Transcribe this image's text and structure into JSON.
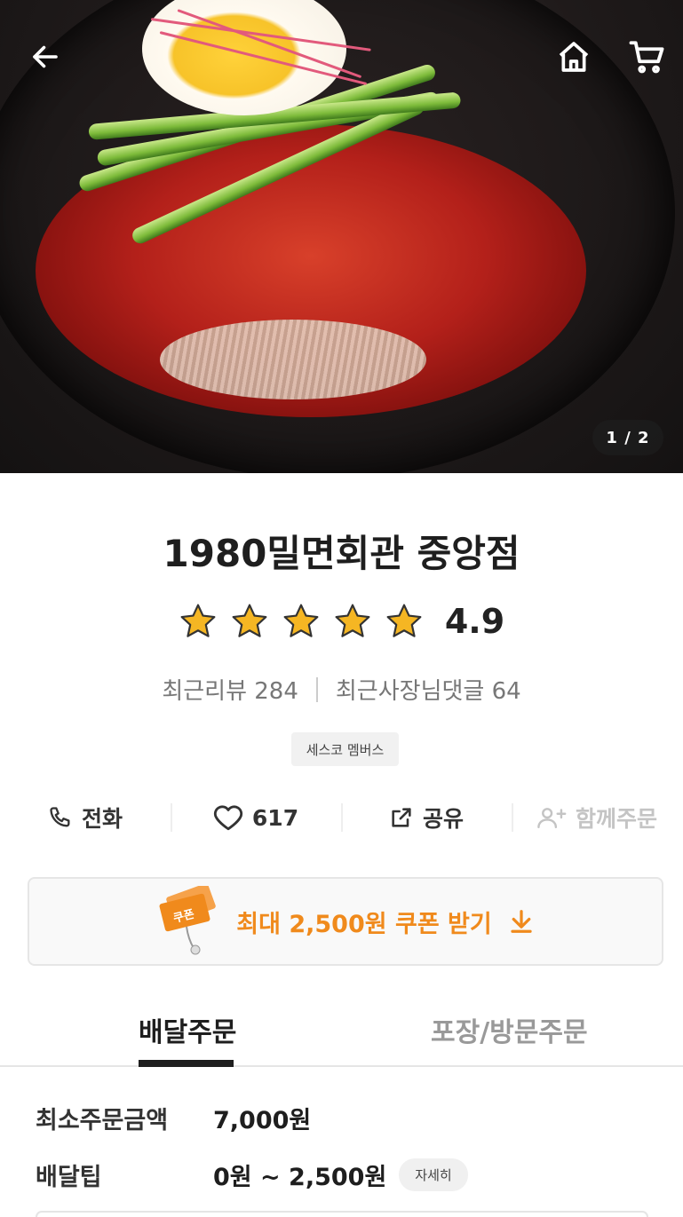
{
  "hero": {
    "page_indicator": "1 / 2",
    "back_icon": "arrow-left-icon",
    "home_icon": "home-icon",
    "cart_icon": "cart-icon"
  },
  "store": {
    "name": "1980밀면회관 중앙점",
    "rating": "4.9",
    "star_count": 5,
    "recent_reviews_label": "최근리뷰 284",
    "owner_comments_label": "최근사장님댓글 64",
    "badge": "세스코 멤버스"
  },
  "actions": {
    "call_label": "전화",
    "like_count": "617",
    "share_label": "공유",
    "group_order_label": "함께주문"
  },
  "coupon": {
    "icon_text": "쿠폰",
    "label": "최대 2,500원 쿠폰 받기"
  },
  "tabs": {
    "delivery": "배달주문",
    "pickup": "포장/방문주문"
  },
  "order_info": {
    "min_order_label": "최소주문금액",
    "min_order_value": "7,000원",
    "delivery_tip_label": "배달팁",
    "delivery_tip_value": "0원 ~ 2,500원",
    "detail_button": "자세히"
  },
  "colors": {
    "accent": "#f08a1c",
    "star": "#f5b623"
  }
}
